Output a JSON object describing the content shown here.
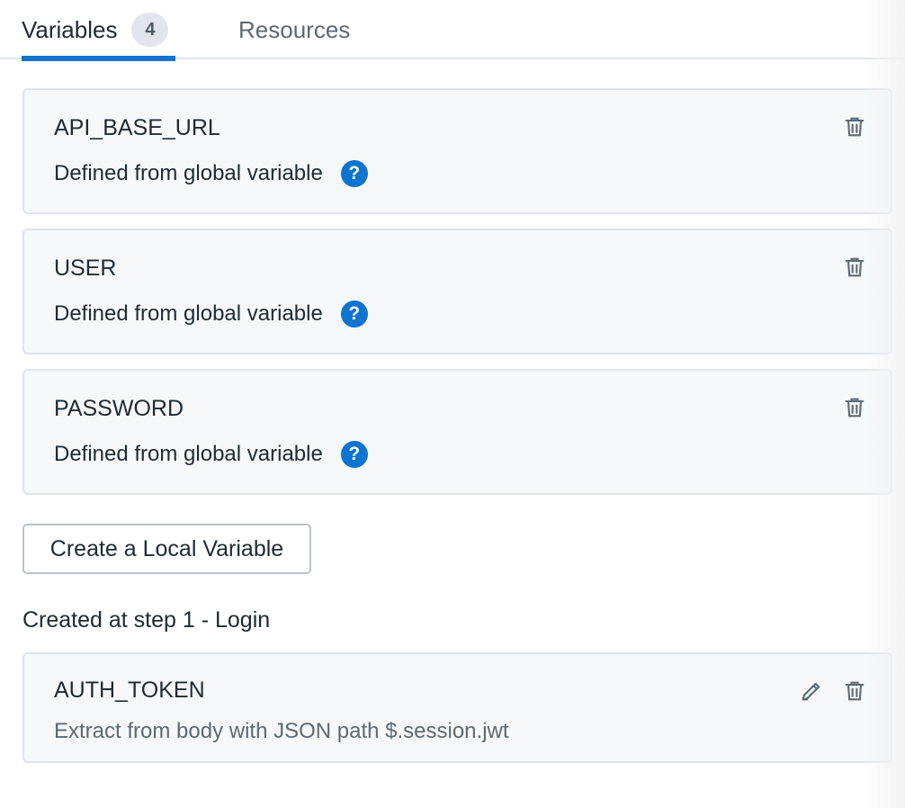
{
  "tabs": [
    {
      "label": "Variables",
      "badge": "4",
      "active": true
    },
    {
      "label": "Resources",
      "active": false
    }
  ],
  "global_variables": [
    {
      "name": "API_BASE_URL",
      "description": "Defined from global variable"
    },
    {
      "name": "USER",
      "description": "Defined from global variable"
    },
    {
      "name": "PASSWORD",
      "description": "Defined from global variable"
    }
  ],
  "help_icon_glyph": "?",
  "create_button_label": "Create a Local Variable",
  "step_section": {
    "heading": "Created at step 1 - Login",
    "variables": [
      {
        "name": "AUTH_TOKEN",
        "description": "Extract from body with JSON path $.session.jwt"
      }
    ]
  },
  "colors": {
    "accent": "#0d74d1",
    "card_bg": "#f7f8fa",
    "border": "#dfe3ea",
    "muted_text": "#5b6a74"
  },
  "icons": {
    "delete": "trash-icon",
    "edit": "pencil-icon",
    "help": "question-circle-icon"
  }
}
